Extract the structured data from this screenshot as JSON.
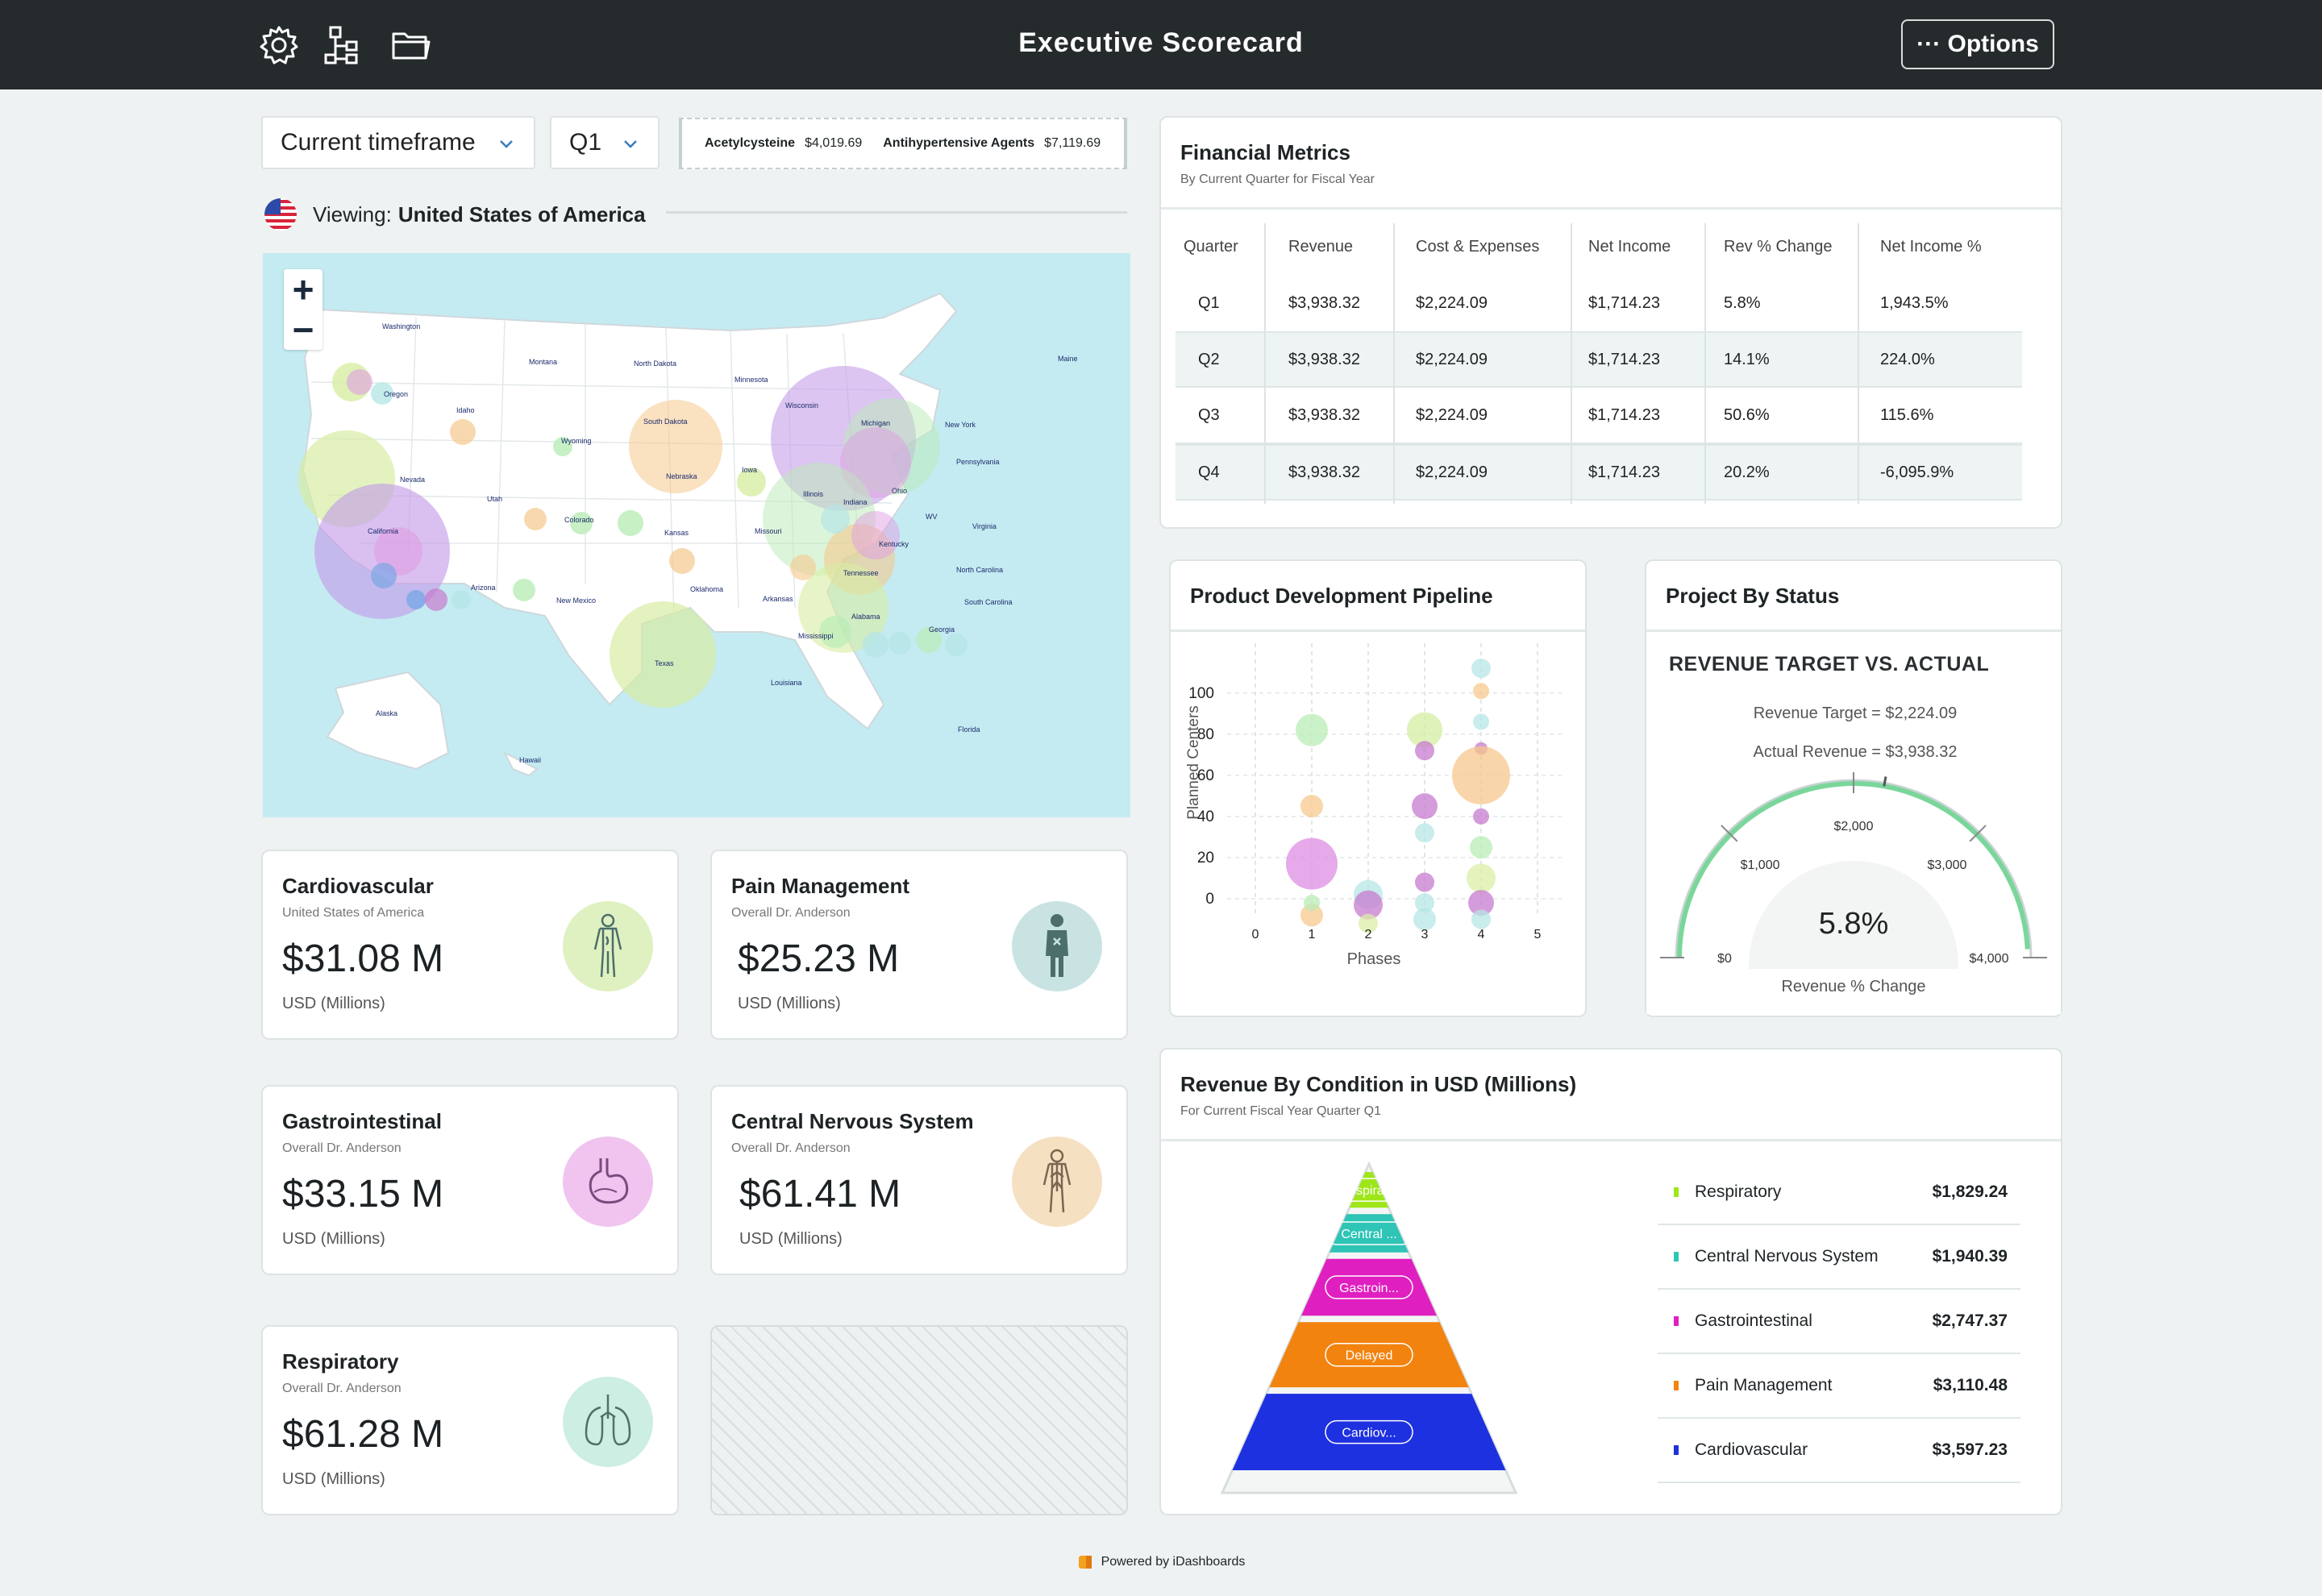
{
  "header": {
    "title": "Executive Scorecard",
    "options_label": "··· Options"
  },
  "filters": {
    "timeframe": "Current timeframe",
    "quarter": "Q1"
  },
  "ticker": [
    {
      "name": "Acetylcysteine",
      "value": "$4,019.69"
    },
    {
      "name": "Antihypertensive Agents",
      "value": "$7,119.69"
    }
  ],
  "viewing": {
    "label": "Viewing:",
    "country": "United States of America"
  },
  "map": {
    "zoom_in": "+",
    "zoom_out": "−",
    "states": [
      {
        "name": "Washington"
      },
      {
        "name": "Montana"
      },
      {
        "name": "North Dakota"
      },
      {
        "name": "Minnesota"
      },
      {
        "name": "Maine"
      },
      {
        "name": "Oregon"
      },
      {
        "name": "Idaho"
      },
      {
        "name": "Wyoming"
      },
      {
        "name": "South Dakota"
      },
      {
        "name": "Wisconsin"
      },
      {
        "name": "Michigan"
      },
      {
        "name": "New York"
      },
      {
        "name": "Pennsylvania"
      },
      {
        "name": "Nevada"
      },
      {
        "name": "Utah"
      },
      {
        "name": "Nebraska"
      },
      {
        "name": "Iowa"
      },
      {
        "name": "Illinois"
      },
      {
        "name": "Ohio"
      },
      {
        "name": "Indiana"
      },
      {
        "name": "WV"
      },
      {
        "name": "Virginia"
      },
      {
        "name": "California"
      },
      {
        "name": "Colorado"
      },
      {
        "name": "Kansas"
      },
      {
        "name": "Missouri"
      },
      {
        "name": "Kentucky"
      },
      {
        "name": "North Carolina"
      },
      {
        "name": "Tennessee"
      },
      {
        "name": "Arizona"
      },
      {
        "name": "New Mexico"
      },
      {
        "name": "Oklahoma"
      },
      {
        "name": "Arkansas"
      },
      {
        "name": "South Carolina"
      },
      {
        "name": "Alabama"
      },
      {
        "name": "Georgia"
      },
      {
        "name": "Mississippi"
      },
      {
        "name": "Texas"
      },
      {
        "name": "Louisiana"
      },
      {
        "name": "Florida"
      },
      {
        "name": "Alaska"
      },
      {
        "name": "Hawaii"
      }
    ]
  },
  "kpis": [
    {
      "title": "Cardiovascular",
      "subtitle": "United States of America",
      "value": "$31.08 M",
      "unit": "USD (Millions)"
    },
    {
      "title": "Pain Management",
      "subtitle": "Overall Dr. Anderson",
      "value": "$25.23 M",
      "unit": "USD (Millions)"
    },
    {
      "title": "Gastrointestinal",
      "subtitle": "Overall Dr. Anderson",
      "value": "$33.15 M",
      "unit": "USD (Millions)"
    },
    {
      "title": "Central Nervous System",
      "subtitle": "Overall Dr. Anderson",
      "value": "$61.41 M",
      "unit": "USD (Millions)"
    },
    {
      "title": "Respiratory",
      "subtitle": "Overall Dr. Anderson",
      "value": "$61.28 M",
      "unit": "USD (Millions)"
    }
  ],
  "financial": {
    "title": "Financial Metrics",
    "subtitle": "By Current Quarter for Fiscal Year",
    "columns": [
      "Quarter",
      "Revenue",
      "Cost & Expenses",
      "Net Income",
      "Rev % Change",
      "Net Income %"
    ],
    "rows": [
      [
        "Q1",
        "$3,938.32",
        "$2,224.09",
        "$1,714.23",
        "5.8%",
        "1,943.5%"
      ],
      [
        "Q2",
        "$3,938.32",
        "$2,224.09",
        "$1,714.23",
        "14.1%",
        "224.0%"
      ],
      [
        "Q3",
        "$3,938.32",
        "$2,224.09",
        "$1,714.23",
        "50.6%",
        "115.6%"
      ],
      [
        "Q4",
        "$3,938.32",
        "$2,224.09",
        "$1,714.23",
        "20.2%",
        "-6,095.9%"
      ]
    ]
  },
  "pipeline": {
    "title": "Product Development Pipeline"
  },
  "status": {
    "title": "Project By Status",
    "subtitle": "REVENUE TARGET VS. ACTUAL",
    "target_line": "Revenue Target = $2,224.09",
    "actual_line": "Actual Revenue = $3,938.32"
  },
  "revenue_condition": {
    "title": "Revenue By Condition in USD (Millions)",
    "subtitle": "For Current Fiscal Year Quarter Q1",
    "pyramid_labels": [
      "Respirat...",
      "Central ...",
      "Gastroin...",
      "Delayed",
      "Cardiov..."
    ],
    "legend": [
      {
        "name": "Respiratory",
        "value": "$1,829.24",
        "color": "#9ee619"
      },
      {
        "name": "Central Nervous System",
        "value": "$1,940.39",
        "color": "#2ec4b6"
      },
      {
        "name": "Gastrointestinal",
        "value": "$2,747.37",
        "color": "#e01fc0"
      },
      {
        "name": "Pain Management",
        "value": "$3,110.48",
        "color": "#f2830f"
      },
      {
        "name": "Cardiovascular",
        "value": "$3,597.23",
        "color": "#1d31e0"
      }
    ]
  },
  "footer": {
    "text": "Powered by iDashboards"
  },
  "chart_data": [
    {
      "type": "scatter",
      "title": "Product Development Pipeline",
      "xlabel": "Phases",
      "ylabel": "Planned Centers",
      "x_ticks": [
        "0",
        "1",
        "2",
        "3",
        "4",
        "5"
      ],
      "y_ticks": [
        "0",
        "20",
        "40",
        "60",
        "80",
        "100"
      ],
      "xlim": [
        -0.5,
        5.5
      ],
      "ylim": [
        -20,
        125
      ],
      "points": [
        {
          "x": 1,
          "y": 82,
          "r": 20,
          "color": "#b9ecb6"
        },
        {
          "x": 1,
          "y": 45,
          "r": 14,
          "color": "#f7c98f"
        },
        {
          "x": 1,
          "y": 17,
          "r": 32,
          "color": "#dd8ee3"
        },
        {
          "x": 1,
          "y": -8,
          "r": 14,
          "color": "#f7c98f"
        },
        {
          "x": 1,
          "y": -2,
          "r": 10,
          "color": "#b9ecb6"
        },
        {
          "x": 2,
          "y": 2,
          "r": 18,
          "color": "#b7e6e6"
        },
        {
          "x": 2,
          "y": -3,
          "r": 18,
          "color": "#c77bcf"
        },
        {
          "x": 2,
          "y": -12,
          "r": 12,
          "color": "#d9eda6"
        },
        {
          "x": 3,
          "y": 82,
          "r": 22,
          "color": "#d3eda1"
        },
        {
          "x": 3,
          "y": 72,
          "r": 12,
          "color": "#c77bcf"
        },
        {
          "x": 3,
          "y": 45,
          "r": 16,
          "color": "#c77bcf"
        },
        {
          "x": 3,
          "y": 32,
          "r": 12,
          "color": "#b7e6e6"
        },
        {
          "x": 3,
          "y": 8,
          "r": 12,
          "color": "#c77bcf"
        },
        {
          "x": 3,
          "y": -2,
          "r": 12,
          "color": "#b7e6e6"
        },
        {
          "x": 3,
          "y": -10,
          "r": 14,
          "color": "#b7e6e6"
        },
        {
          "x": 4,
          "y": 112,
          "r": 12,
          "color": "#b7e6e6"
        },
        {
          "x": 4,
          "y": 101,
          "r": 10,
          "color": "#f7c98f"
        },
        {
          "x": 4,
          "y": 86,
          "r": 10,
          "color": "#b7e6e6"
        },
        {
          "x": 4,
          "y": 73,
          "r": 8,
          "color": "#c77bcf"
        },
        {
          "x": 4,
          "y": 60,
          "r": 36,
          "color": "#f5c88c"
        },
        {
          "x": 4,
          "y": 40,
          "r": 10,
          "color": "#c77bcf"
        },
        {
          "x": 4,
          "y": 25,
          "r": 14,
          "color": "#b9ecb6"
        },
        {
          "x": 4,
          "y": 10,
          "r": 18,
          "color": "#dbeea5"
        },
        {
          "x": 4,
          "y": -2,
          "r": 16,
          "color": "#c77bcf"
        },
        {
          "x": 4,
          "y": -10,
          "r": 12,
          "color": "#b7e6e6"
        }
      ]
    },
    {
      "type": "gauge",
      "title": "Project By Status",
      "min": 0,
      "max": 4000,
      "ticks": [
        "$0",
        "$1,000",
        "$2,000",
        "$3,000",
        "$4,000"
      ],
      "tick_values": [
        0,
        1000,
        2000,
        3000,
        4000
      ],
      "target": 2224.09,
      "actual": 3938.32,
      "center_value": "5.8%",
      "caption": "Revenue % Change"
    },
    {
      "type": "pyramid",
      "title": "Revenue By Condition in USD (Millions)",
      "categories": [
        "Respiratory",
        "Central Nervous System",
        "Gastrointestinal",
        "Pain Management",
        "Cardiovascular"
      ],
      "values": [
        1829.24,
        1940.39,
        2747.37,
        3110.48,
        3597.23
      ]
    }
  ]
}
